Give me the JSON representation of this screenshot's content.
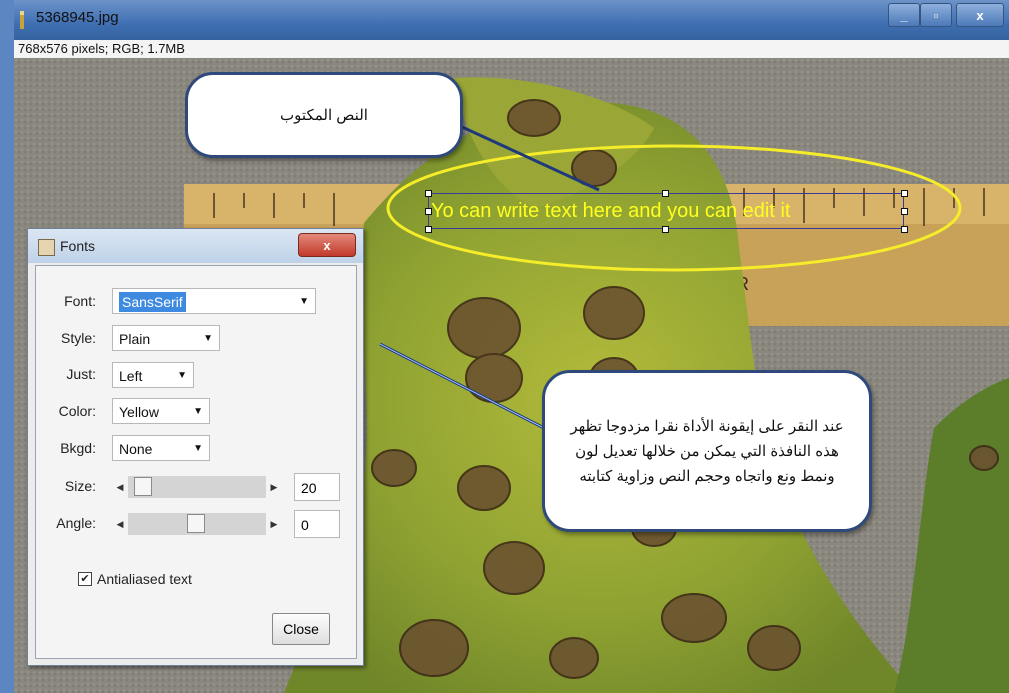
{
  "window": {
    "title": "5368945.jpg",
    "info": "768x576 pixels; RGB; 1.7MB",
    "minimize": "_",
    "maximize": "▫",
    "close": "x"
  },
  "image_overlay": {
    "text": "Yo can write text here and you can edit it"
  },
  "callouts": {
    "top": "النص المكتوب",
    "right": "عند النقر على إيقونة الأداة نقرا مزدوجا تظهر هذه النافذة التي يمكن من خلالها تعديل لون ونمط ونع واتجاه وحجم النص وزاوية كتابته"
  },
  "fonts_dialog": {
    "title": "Fonts",
    "close_x": "x",
    "font_label": "Font:",
    "font_value": "SansSerif",
    "style_label": "Style:",
    "style_value": "Plain",
    "just_label": "Just:",
    "just_value": "Left",
    "color_label": "Color:",
    "color_value": "Yellow",
    "bkgd_label": "Bkgd:",
    "bkgd_value": "None",
    "size_label": "Size:",
    "size_value": "20",
    "angle_label": "Angle:",
    "angle_value": "0",
    "antialiased_label": "Antialiased text",
    "antialiased_checked": true,
    "close_button": "Close"
  },
  "colors": {
    "overlay_text": "#ffff1e",
    "highlight": "#3d8ae0",
    "callout_border": "#2f4a7a"
  }
}
